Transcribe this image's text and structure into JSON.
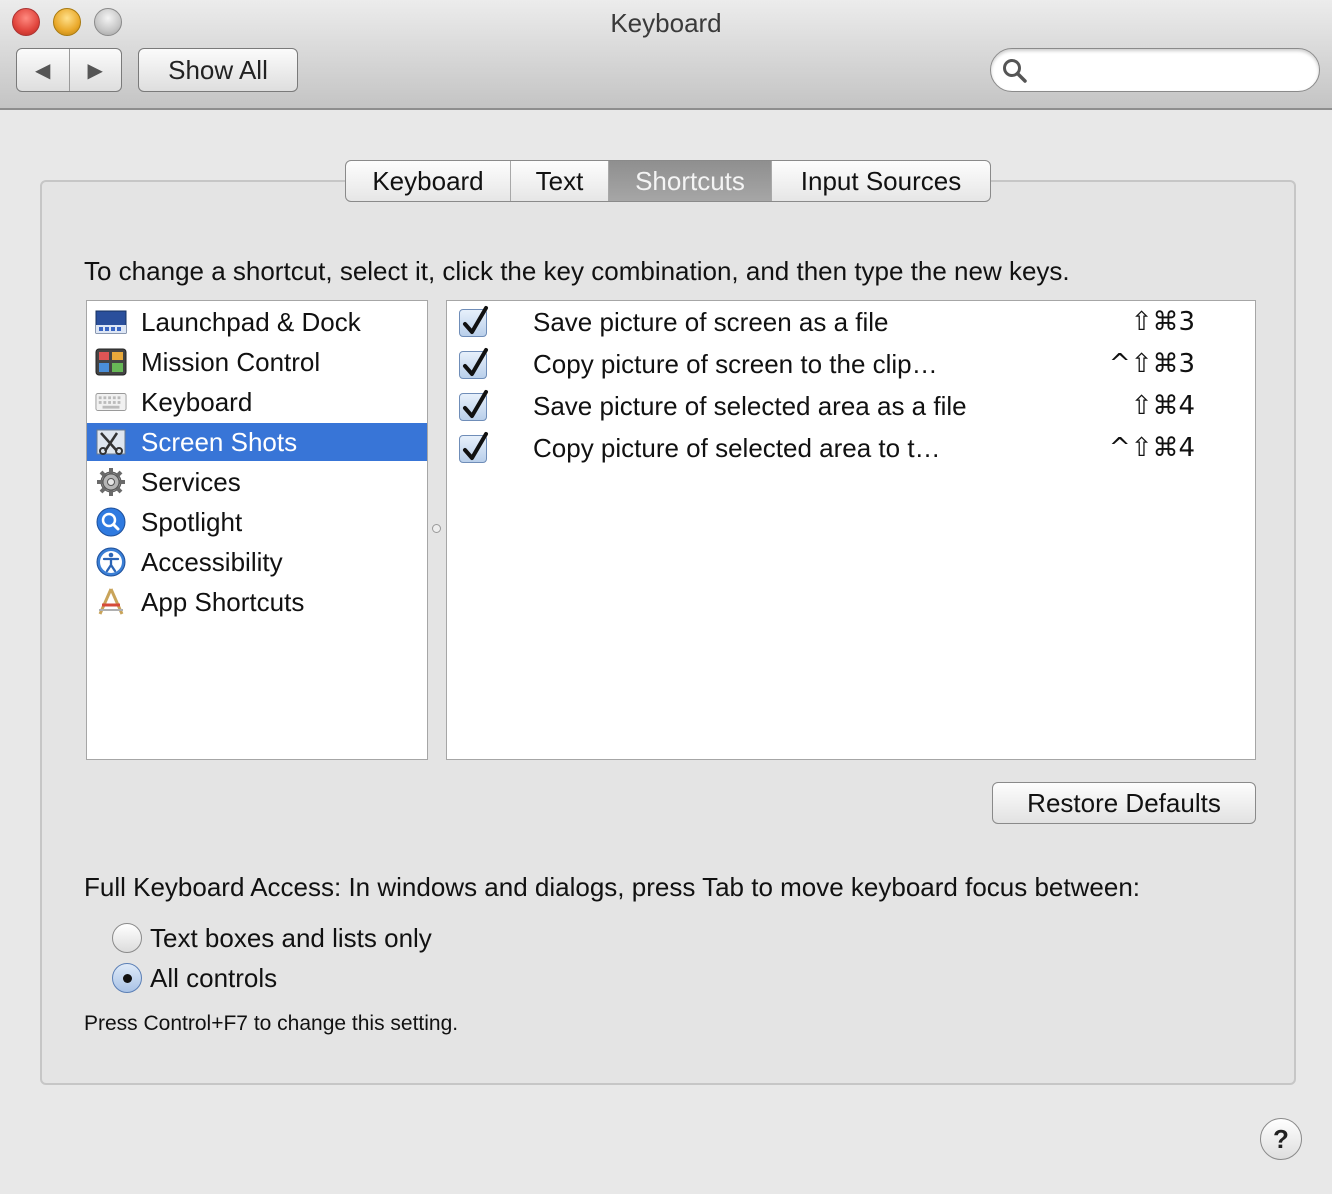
{
  "window": {
    "title": "Keyboard",
    "back_icon": "◀",
    "forward_icon": "▶",
    "show_all_label": "Show All",
    "search_placeholder": ""
  },
  "tabs": [
    {
      "label": "Keyboard",
      "selected": false
    },
    {
      "label": "Text",
      "selected": false
    },
    {
      "label": "Shortcuts",
      "selected": true
    },
    {
      "label": "Input Sources",
      "selected": false
    }
  ],
  "instruction": "To change a shortcut, select it, click the key combination, and then type the new keys.",
  "categories": [
    {
      "label": "Launchpad & Dock",
      "icon": "launchpad-dock-icon"
    },
    {
      "label": "Mission Control",
      "icon": "mission-control-icon"
    },
    {
      "label": "Keyboard",
      "icon": "keyboard-icon"
    },
    {
      "label": "Screen Shots",
      "icon": "screen-shots-icon",
      "selected": true
    },
    {
      "label": "Services",
      "icon": "gear-icon"
    },
    {
      "label": "Spotlight",
      "icon": "spotlight-icon"
    },
    {
      "label": "Accessibility",
      "icon": "accessibility-icon"
    },
    {
      "label": "App Shortcuts",
      "icon": "app-shortcuts-icon"
    }
  ],
  "shortcuts": [
    {
      "label": "Save picture of screen as a file",
      "keys": "⇧⌘3",
      "checked": true
    },
    {
      "label": "Copy picture of screen to the clip…",
      "keys": "^⇧⌘3",
      "checked": true
    },
    {
      "label": "Save picture of selected area as a file",
      "keys": "⇧⌘4",
      "checked": true
    },
    {
      "label": "Copy picture of selected area to t…",
      "keys": "^⇧⌘4",
      "checked": true
    }
  ],
  "restore_defaults_label": "Restore Defaults",
  "full_keyboard_access": {
    "text": "Full Keyboard Access: In windows and dialogs, press Tab to move keyboard focus between:",
    "options": [
      {
        "label": "Text boxes and lists only",
        "selected": false
      },
      {
        "label": "All controls",
        "selected": true
      }
    ],
    "hint": "Press Control+F7 to change this setting."
  },
  "help_label": "?"
}
